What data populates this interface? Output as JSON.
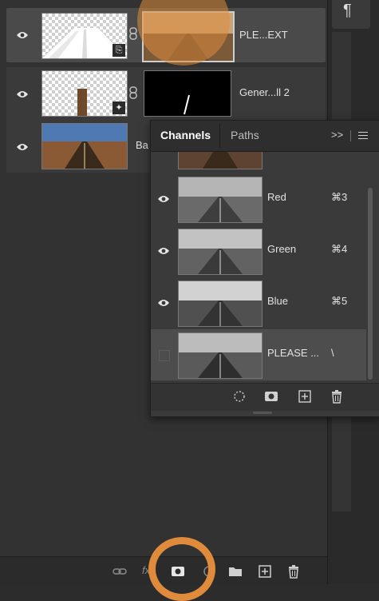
{
  "layers": [
    {
      "name": "PLE...EXT",
      "visible": true,
      "selected": true,
      "mask_badge_icon": "smart-object-icon"
    },
    {
      "name": "Gener...ll 2",
      "visible": true,
      "selected": false,
      "mask_badge_icon": "generative-fill-icon"
    },
    {
      "name": "Ba",
      "visible": true,
      "selected": false
    }
  ],
  "channels_panel": {
    "tabs": [
      {
        "label": "Channels",
        "active": true
      },
      {
        "label": "Paths",
        "active": false
      }
    ],
    "collapse_label": ">>",
    "channels": [
      {
        "name": "Red",
        "shortcut": "⌘3",
        "visible": true
      },
      {
        "name": "Green",
        "shortcut": "⌘4",
        "visible": true
      },
      {
        "name": "Blue",
        "shortcut": "⌘5",
        "visible": true
      },
      {
        "name": "PLEASE ...",
        "shortcut": "\\",
        "visible": false,
        "selected": true
      }
    ],
    "footer_icons": [
      "load-selection-icon",
      "save-selection-mask-icon",
      "new-channel-icon",
      "delete-channel-icon"
    ]
  },
  "right_strip": {
    "paragraph_symbol": "¶"
  },
  "bottom_toolbar": {
    "icons": [
      "link-layers-icon",
      "fx-icon",
      "add-mask-icon",
      "adjustment-icon",
      "group-folder-icon",
      "new-layer-icon",
      "delete-layer-icon"
    ],
    "fx_label": "fx"
  },
  "colors": {
    "highlight": "#e08b3c",
    "panel_bg": "#323232",
    "selected_row": "#4a4a4a"
  }
}
